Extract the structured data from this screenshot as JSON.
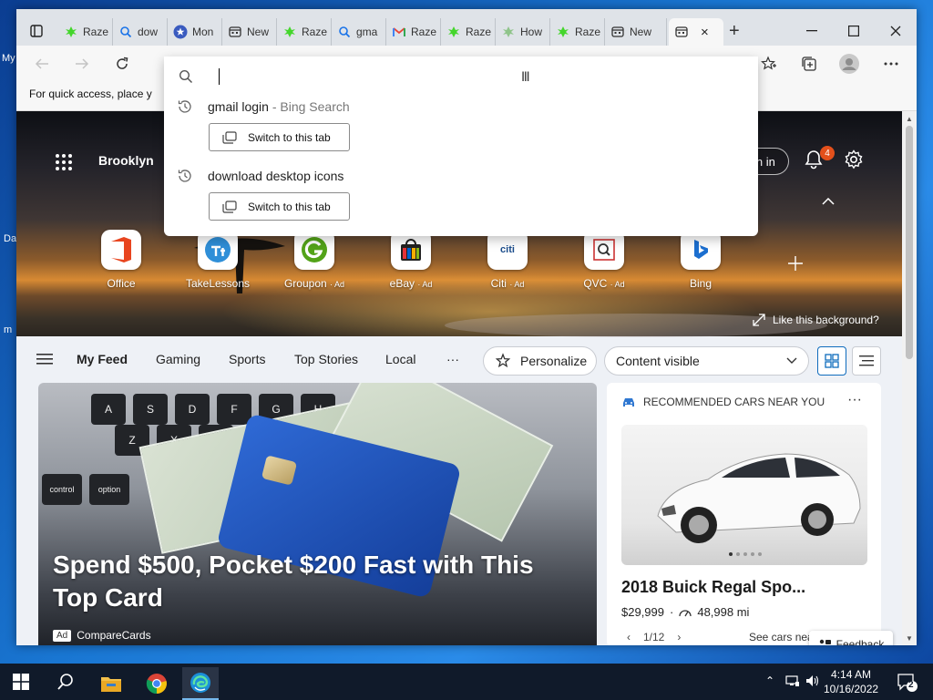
{
  "desktop": {
    "fragments": [
      "My",
      "Da",
      "m"
    ]
  },
  "browser": {
    "tabs": [
      {
        "label": "Raze",
        "icon": "razer-icon"
      },
      {
        "label": "dow",
        "icon": "search-icon"
      },
      {
        "label": "Mon",
        "icon": "star-icon"
      },
      {
        "label": "New",
        "icon": "newtab-icon"
      },
      {
        "label": "Raze",
        "icon": "razer-icon"
      },
      {
        "label": "gma",
        "icon": "search-icon"
      },
      {
        "label": "Raze",
        "icon": "gmail-icon"
      },
      {
        "label": "Raze",
        "icon": "razer-icon"
      },
      {
        "label": "How",
        "icon": "razer-icon"
      },
      {
        "label": "Raze",
        "icon": "razer-icon"
      },
      {
        "label": "New",
        "icon": "newtab-icon"
      }
    ],
    "active_tab_close": "×",
    "newtab_symbol": "+",
    "favorites_bar_text": "For quick access, place y"
  },
  "address_dropdown": {
    "input_value": "",
    "suggestions": [
      {
        "text": "gmail login",
        "subtext": "- Bing Search",
        "action": "Switch to this tab"
      },
      {
        "text": "download desktop icons",
        "subtext": "",
        "action": "Switch to this tab"
      }
    ]
  },
  "hero": {
    "location": "Brooklyn",
    "signin_label": "Sign in",
    "notification_count": "4",
    "like_background": "Like this background?",
    "quick_links": [
      {
        "label": "Office",
        "ad": ""
      },
      {
        "label": "TakeLessons",
        "ad": ""
      },
      {
        "label": "Groupon",
        "ad": "· Ad"
      },
      {
        "label": "eBay",
        "ad": "· Ad"
      },
      {
        "label": "Citi",
        "ad": "· Ad"
      },
      {
        "label": "QVC",
        "ad": "· Ad"
      },
      {
        "label": "Bing",
        "ad": ""
      }
    ],
    "citi_text": "citi"
  },
  "feed": {
    "nav": [
      "My Feed",
      "Gaming",
      "Sports",
      "Top Stories",
      "Local"
    ],
    "more": "···",
    "personalize": "Personalize",
    "content_visible": "Content visible"
  },
  "main_card": {
    "headline": "Spend $500, Pocket $200 Fast with This Top Card",
    "ad_tag": "Ad",
    "source": "CompareCards",
    "keys_row1": [
      "A",
      "S",
      "D",
      "F",
      "G",
      "H"
    ],
    "keys_row2": [
      "Z",
      "X",
      "C"
    ],
    "keys_row3": [
      "control",
      "option"
    ]
  },
  "side_card": {
    "header": "RECOMMENDED CARS NEAR YOU",
    "more": "···",
    "title": "2018 Buick Regal Spo...",
    "price": "$29,999",
    "separator": "·",
    "mileage": "48,998 mi",
    "pager": "1/12",
    "see_cars": "See cars nea"
  },
  "feedback_label": "Feedback",
  "taskbar": {
    "time": "4:14 AM",
    "date": "10/16/2022",
    "notification_count": "2"
  },
  "colors": {
    "accent": "#0f6cbd",
    "badge": "#e3501b",
    "razer": "#44d62c"
  }
}
